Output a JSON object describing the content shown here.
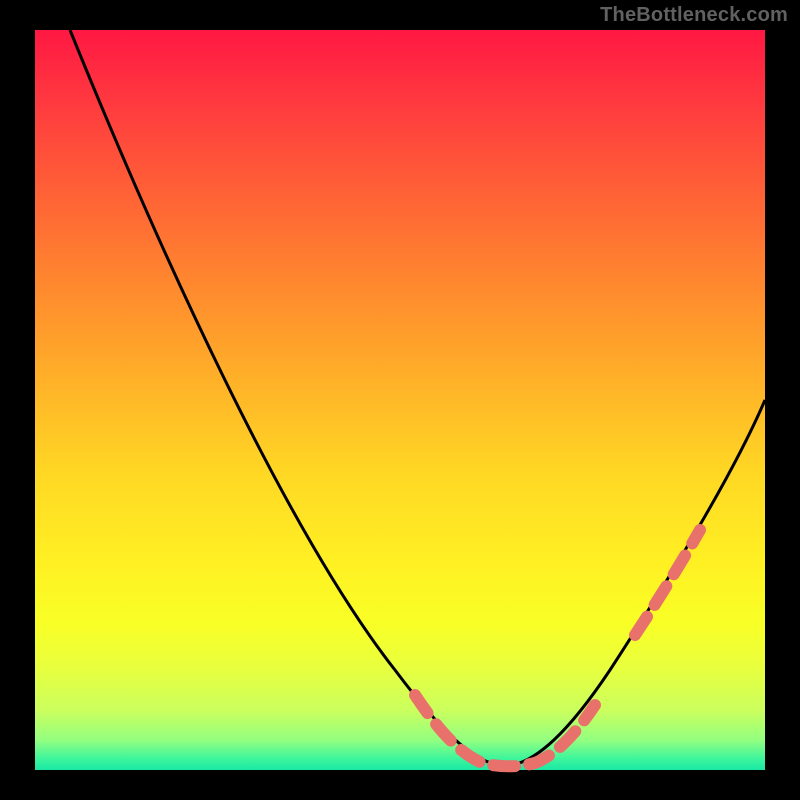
{
  "watermark": "TheBottleneck.com",
  "colors": {
    "background": "#000000",
    "curve_stroke": "#000000",
    "dash_stroke": "#e9716b",
    "gradient_top": "#ff1843",
    "gradient_bottom": "#19e8a4"
  },
  "chart_data": {
    "type": "line",
    "title": "",
    "xlabel": "",
    "ylabel": "",
    "xlim": [
      0,
      100
    ],
    "ylim": [
      0,
      100
    ],
    "x": [
      5,
      10,
      15,
      20,
      25,
      30,
      35,
      40,
      45,
      50,
      52,
      55,
      58,
      60,
      62,
      65,
      68,
      70,
      75,
      80,
      85,
      90,
      95,
      100
    ],
    "values": [
      100,
      91,
      82,
      73,
      64,
      55,
      46,
      37,
      28,
      19,
      14,
      9,
      5,
      3,
      2,
      1,
      1,
      2,
      7,
      15,
      23,
      32,
      41,
      50
    ],
    "series": [
      {
        "name": "bottleneck-curve",
        "x": [
          5,
          10,
          15,
          20,
          25,
          30,
          35,
          40,
          45,
          50,
          52,
          55,
          58,
          60,
          62,
          65,
          68,
          70,
          75,
          80,
          85,
          90,
          95,
          100
        ],
        "y": [
          100,
          91,
          82,
          73,
          64,
          55,
          46,
          37,
          28,
          19,
          14,
          9,
          5,
          3,
          2,
          1,
          1,
          2,
          7,
          15,
          23,
          32,
          41,
          50
        ]
      }
    ],
    "highlight_ranges": [
      {
        "x_start": 55,
        "x_end": 70
      },
      {
        "x_start": 80,
        "x_end": 88
      }
    ],
    "annotations": []
  }
}
